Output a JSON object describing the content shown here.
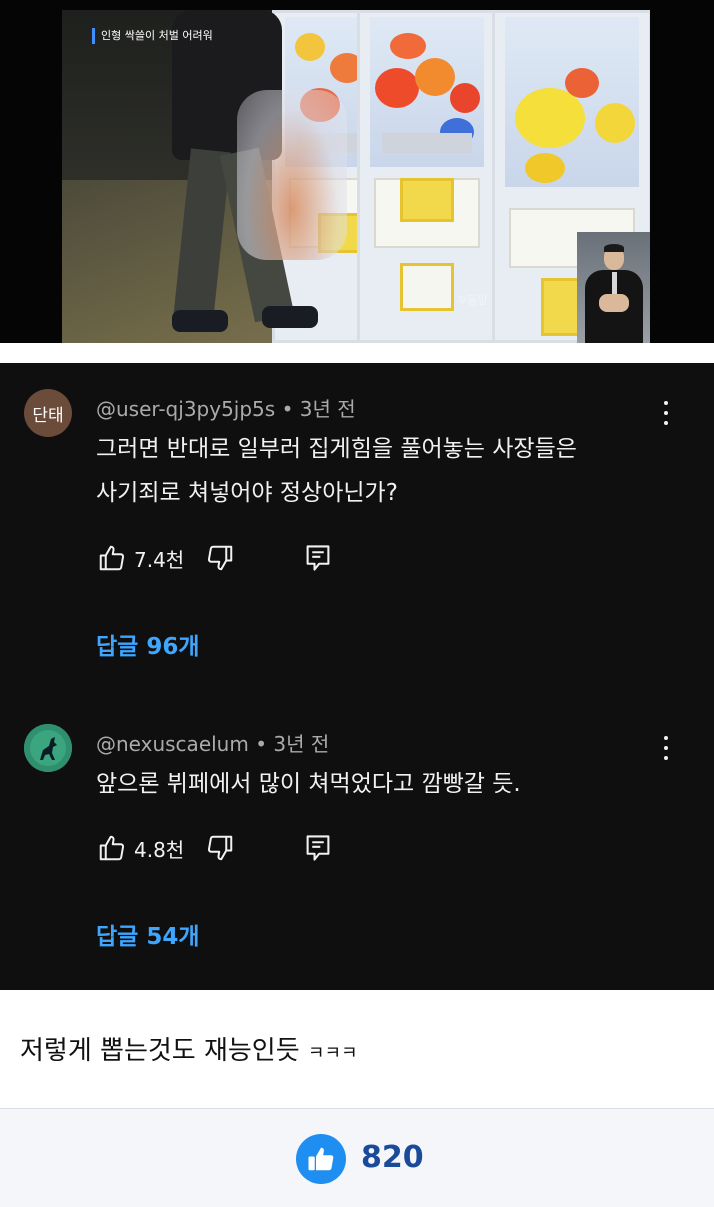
{
  "video": {
    "caption": "인형 싹쓸이 처벌 어려워",
    "watermark": "부동일"
  },
  "comments": [
    {
      "avatar_text": "단태",
      "author": "@user-qj3py5jp5s",
      "time": "3년 전",
      "lines": [
        "그러면 반대로 일부러 집게힘을 풀어놓는 사장들은",
        "사기죄로 쳐넣어야 정상아닌가?"
      ],
      "likes": "7.4천",
      "replies": "답글 96개"
    },
    {
      "avatar_text": "",
      "author": "@nexuscaelum",
      "time": "3년 전",
      "lines": [
        "앞으론 뷔페에서 많이 쳐먹었다고 깜빵갈 듯."
      ],
      "likes": "4.8천",
      "replies": "답글 54개"
    }
  ],
  "post": {
    "text": "저렇게 뽑는것도 재능인듯",
    "suffix": "ㅋㅋㅋ"
  },
  "like_bar": {
    "count": "820"
  },
  "colors": {
    "comment_bg": "#0f0f0f",
    "reply_link": "#3ea6ff",
    "like_button": "#1e8ef0",
    "like_count": "#1a4a9a"
  },
  "icons": {
    "like": "thumbs-up-icon",
    "dislike": "thumbs-down-icon",
    "reply": "reply-icon",
    "more": "more-vert-icon"
  }
}
